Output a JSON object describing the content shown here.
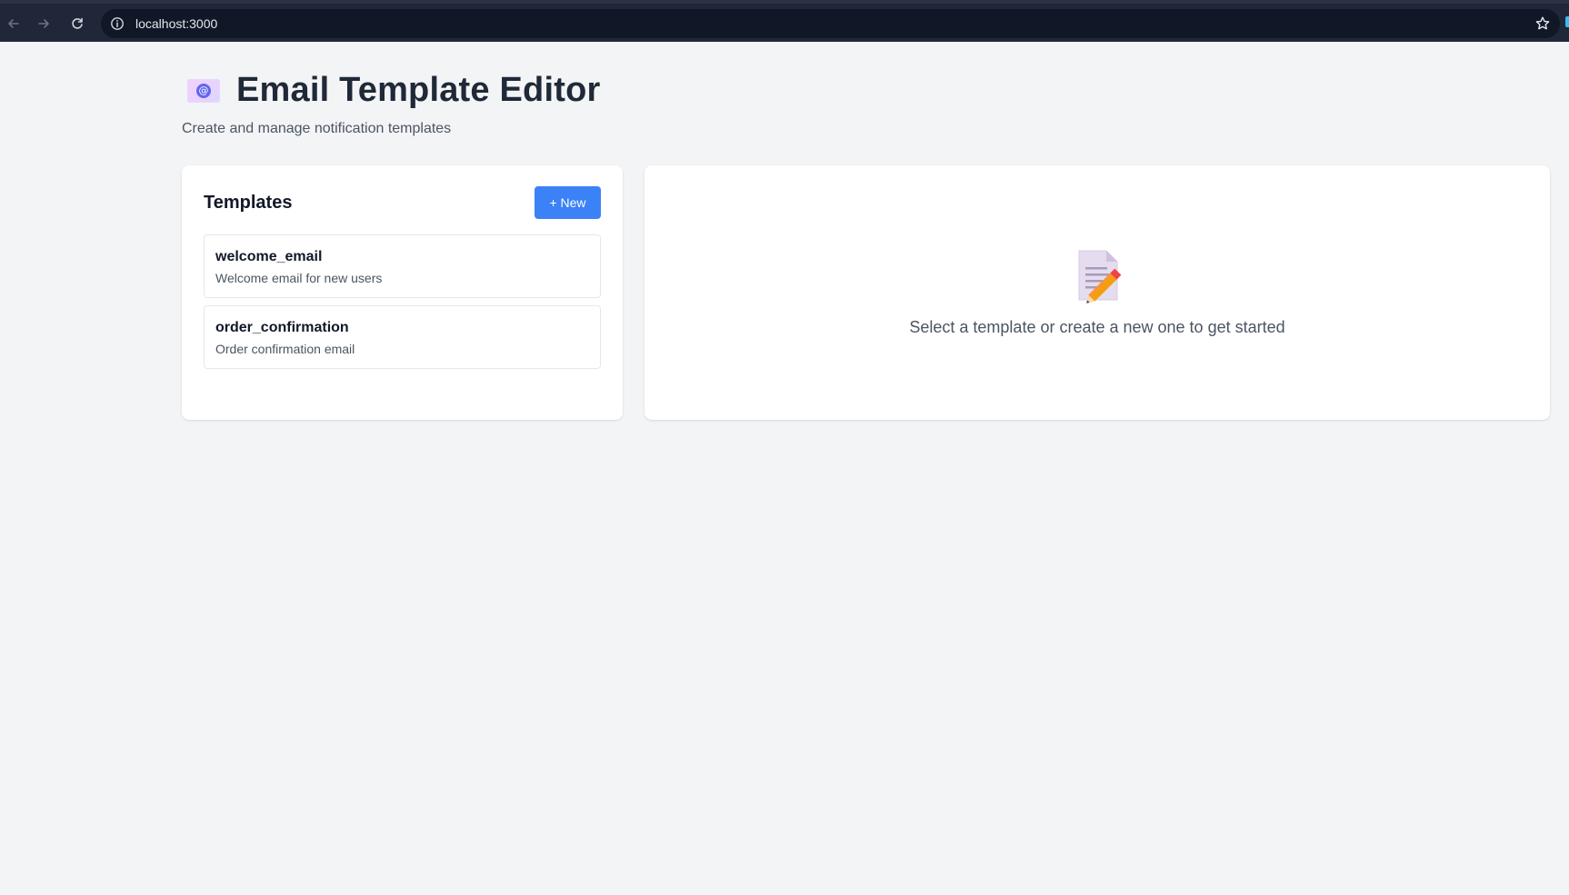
{
  "browser": {
    "url": "localhost:3000"
  },
  "header": {
    "title": "Email Template Editor",
    "subtitle": "Create and manage notification templates",
    "icon": "email-icon"
  },
  "templates_panel": {
    "title": "Templates",
    "new_button_label": "+ New",
    "items": [
      {
        "name": "welcome_email",
        "description": "Welcome email for new users"
      },
      {
        "name": "order_confirmation",
        "description": "Order confirmation email"
      }
    ]
  },
  "editor_panel": {
    "empty_icon": "memo-pencil-icon",
    "empty_message": "Select a template or create a new one to get started"
  },
  "colors": {
    "accent": "#3b82f6",
    "background": "#f3f4f6",
    "chrome": "#1f2738"
  }
}
